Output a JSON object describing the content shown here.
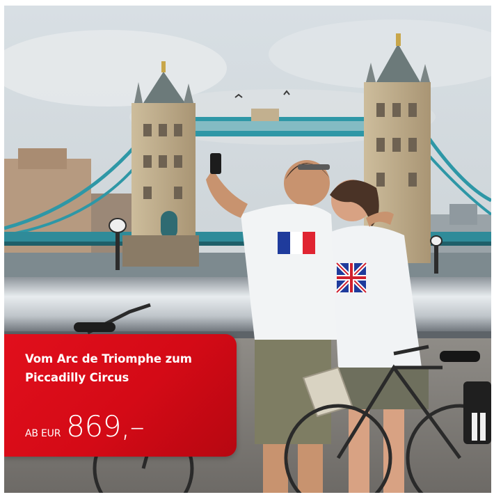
{
  "offer": {
    "title": "Vom Arc de Triomphe zum Piccadilly Circus",
    "price_prefix": "AB EUR",
    "price_value": "869,–"
  },
  "colors": {
    "offer_red": "#d40a16",
    "bridge_stone": "#b9a788",
    "bridge_teal": "#2e97a6",
    "sky": "#c9d3d9"
  },
  "icons": {
    "left_flag": "french-flag-icon",
    "right_flag": "union-jack-icon"
  }
}
